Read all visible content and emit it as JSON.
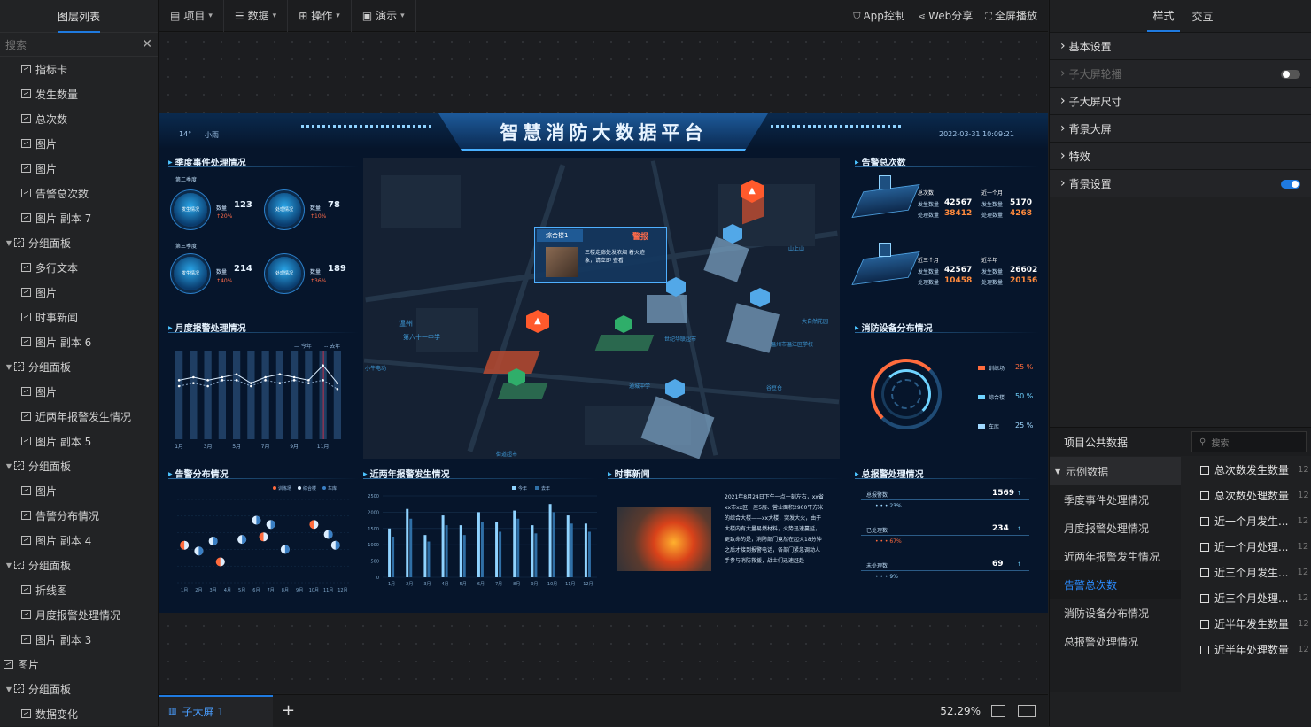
{
  "left_panel": {
    "title": "图层列表",
    "search_placeholder": "搜索",
    "layers": [
      {
        "label": "指标卡",
        "group": false,
        "indent": 1
      },
      {
        "label": "发生数量",
        "group": false,
        "indent": 1
      },
      {
        "label": "总次数",
        "group": false,
        "indent": 1
      },
      {
        "label": "图片",
        "group": false,
        "indent": 1
      },
      {
        "label": "图片",
        "group": false,
        "indent": 1
      },
      {
        "label": "告警总次数",
        "group": false,
        "indent": 1
      },
      {
        "label": "图片 副本 7",
        "group": false,
        "indent": 1
      },
      {
        "label": "分组面板",
        "group": true,
        "indent": 0
      },
      {
        "label": "多行文本",
        "group": false,
        "indent": 1
      },
      {
        "label": "图片",
        "group": false,
        "indent": 1
      },
      {
        "label": "时事新闻",
        "group": false,
        "indent": 1
      },
      {
        "label": "图片 副本 6",
        "group": false,
        "indent": 1
      },
      {
        "label": "分组面板",
        "group": true,
        "indent": 0
      },
      {
        "label": "图片",
        "group": false,
        "indent": 1
      },
      {
        "label": "近两年报警发生情况",
        "group": false,
        "indent": 1
      },
      {
        "label": "图片 副本 5",
        "group": false,
        "indent": 1
      },
      {
        "label": "分组面板",
        "group": true,
        "indent": 0
      },
      {
        "label": "图片",
        "group": false,
        "indent": 1
      },
      {
        "label": "告警分布情况",
        "group": false,
        "indent": 1
      },
      {
        "label": "图片 副本 4",
        "group": false,
        "indent": 1
      },
      {
        "label": "分组面板",
        "group": true,
        "indent": 0
      },
      {
        "label": "折线图",
        "group": false,
        "indent": 1
      },
      {
        "label": "月度报警处理情况",
        "group": false,
        "indent": 1
      },
      {
        "label": "图片 副本 3",
        "group": false,
        "indent": 1
      },
      {
        "label": "图片",
        "group": false,
        "indent": -1
      },
      {
        "label": "分组面板",
        "group": true,
        "indent": 0
      },
      {
        "label": "数据变化",
        "group": false,
        "indent": 1
      }
    ]
  },
  "toolbar": {
    "menus": [
      "项目",
      "数据",
      "操作",
      "演示"
    ],
    "app_control": "App控制",
    "web_share": "Web分享",
    "fullscreen": "全屏播放"
  },
  "bottom": {
    "tab_label": "子大屏 1",
    "zoom": "52.29%"
  },
  "right_panel": {
    "tab_style": "样式",
    "tab_interact": "交互",
    "sections": [
      {
        "label": "基本设置",
        "dim": false,
        "toggle": ""
      },
      {
        "label": "子大屏轮播",
        "dim": true,
        "toggle": "off"
      },
      {
        "label": "子大屏尺寸",
        "dim": false,
        "toggle": ""
      },
      {
        "label": "背景大屏",
        "dim": false,
        "toggle": ""
      },
      {
        "label": "特效",
        "dim": false,
        "toggle": ""
      },
      {
        "label": "背景设置",
        "dim": false,
        "toggle": "on"
      }
    ],
    "public_data_title": "项目公共数据",
    "public_search_placeholder": "搜索",
    "dataset_group": "示例数据",
    "datasets": [
      "季度事件处理情况",
      "月度报警处理情况",
      "近两年报警发生情况",
      "告警总次数",
      "消防设备分布情况",
      "总报警处理情况"
    ],
    "selected_dataset": "告警总次数",
    "fields": [
      "总次数发生数量",
      "总次数处理数量",
      "近一个月发生...",
      "近一个月处理...",
      "近三个月发生...",
      "近三个月处理...",
      "近半年发生数量",
      "近半年处理数量"
    ],
    "field_value_preview": "12"
  },
  "screen": {
    "title": "智慧消防大数据平台",
    "temp": "14°",
    "weather": "小雨",
    "datetime": "2022-03-31 10:09:21",
    "p_quarter": "季度事件处理情况",
    "p_monthly": "月度报警处理情况",
    "p_alarm_total": "告警总次数",
    "p_device": "消防设备分布情况",
    "p_alarm_dist": "告警分布情况",
    "p_two_year": "近两年报警发生情况",
    "p_news": "时事新闻",
    "p_total_handle": "总报警处理情况",
    "q2_label": "第二季度",
    "q3_label": "第三季度",
    "gauge_occur": "发生情况",
    "gauge_handle": "处理情况",
    "count_label": "数量",
    "q_stats": [
      {
        "val": "123",
        "pct": "20%"
      },
      {
        "val": "78",
        "pct": "10%"
      },
      {
        "val": "214",
        "pct": "40%"
      },
      {
        "val": "189",
        "pct": "36%"
      }
    ],
    "alarm_blocks": [
      {
        "h1": "总次数",
        "h2": "近一个月",
        "a_lab": "发生数量",
        "b_lab": "处理数量",
        "a1": "42567",
        "b1": "38412",
        "a2": "5170",
        "b2": "4268"
      },
      {
        "h1": "近三个月",
        "h2": "近半年",
        "a_lab": "发生数量",
        "b_lab": "处理数量",
        "a1": "42567",
        "b1": "10458",
        "a2": "26602",
        "b2": "20156"
      }
    ],
    "devices": [
      {
        "name": "训练场",
        "pct": "25 %",
        "color": "#ff6b3d"
      },
      {
        "name": "综合楼",
        "pct": "50 %",
        "color": "#6fd3ff"
      },
      {
        "name": "车库",
        "pct": "25 %",
        "color": "#9fd8ff"
      }
    ],
    "alert_popup_title": "综合楼1",
    "alert_popup_tag": "警报",
    "alert_popup_text": "三楼走廊处发浓烟 着火迹象，请立即 查看",
    "map_labels": [
      "温州",
      "第六十一中学",
      "世纪华联超市",
      "温州市温江区学校",
      "大自然花园",
      "山上山",
      "小牛电动",
      "通城中学",
      "谷豆仓",
      "街道超市"
    ],
    "news_text": "2021年8月24日下午一点一刻左右，xx省xx市xx区一座5层、营业面积2900平方米的综合大楼——xx大楼，突发大火，由于大楼内有大量易燃材料，火势迅速蔓延，更致命的是，消防部门竟然在起火18分钟之后才接到报警电话，各部门紧急调动人手参与消防救援，战士们迅速赶赴",
    "handle_rows": [
      {
        "label": "总报警数",
        "val": "1569",
        "pct": "23%"
      },
      {
        "label": "已处理数",
        "val": "234",
        "pct": "67%"
      },
      {
        "label": "未处理数",
        "val": "69",
        "pct": "9%"
      }
    ],
    "legend_2y": [
      "今年",
      "去年"
    ],
    "legend_dist": [
      "训练场",
      "综合楼",
      "车库"
    ],
    "legend_month": [
      "今年",
      "去年"
    ]
  },
  "chart_data": [
    {
      "type": "bar",
      "title": "月度报警处理情况",
      "categories": [
        "1月",
        "3月",
        "5月",
        "7月",
        "9月",
        "11月"
      ],
      "series": [
        {
          "name": "今年",
          "values": [
            8,
            9,
            8,
            9,
            10,
            7,
            9,
            10,
            9,
            8,
            13,
            7
          ]
        },
        {
          "name": "去年",
          "values": [
            6,
            7,
            6,
            8,
            8,
            6,
            8,
            7,
            8,
            7,
            8,
            5
          ]
        }
      ],
      "ylim": [
        0,
        30
      ]
    },
    {
      "type": "bar",
      "title": "近两年报警发生情况",
      "categories": [
        "1月",
        "2月",
        "3月",
        "4月",
        "5月",
        "6月",
        "7月",
        "8月",
        "9月",
        "10月",
        "11月",
        "12月"
      ],
      "y_ticks": [
        "2500",
        "2000",
        "1500",
        "1000",
        "500",
        "0"
      ],
      "series": [
        {
          "name": "今年",
          "values": [
            1500,
            2100,
            1300,
            1900,
            1600,
            2000,
            1700,
            2050,
            1600,
            2250,
            1900,
            1650
          ]
        },
        {
          "name": "去年",
          "values": [
            1250,
            1800,
            1100,
            1600,
            1300,
            1700,
            1400,
            1800,
            1350,
            2000,
            1650,
            1400
          ]
        }
      ],
      "ylim": [
        0,
        2500
      ]
    },
    {
      "type": "scatter",
      "title": "告警分布情况",
      "categories": [
        "1月",
        "2月",
        "3月",
        "4月",
        "5月",
        "6月",
        "7月",
        "8月",
        "9月",
        "10月",
        "11月",
        "12月"
      ],
      "points": [
        {
          "x": 1,
          "y": 45
        },
        {
          "x": 2,
          "y": 38
        },
        {
          "x": 3,
          "y": 50
        },
        {
          "x": 3.5,
          "y": 25
        },
        {
          "x": 5,
          "y": 52
        },
        {
          "x": 6,
          "y": 75
        },
        {
          "x": 6.5,
          "y": 55
        },
        {
          "x": 7,
          "y": 70
        },
        {
          "x": 8,
          "y": 40
        },
        {
          "x": 10,
          "y": 70
        },
        {
          "x": 11,
          "y": 58
        },
        {
          "x": 11.5,
          "y": 45
        }
      ],
      "ylim": [
        0,
        100
      ]
    }
  ]
}
